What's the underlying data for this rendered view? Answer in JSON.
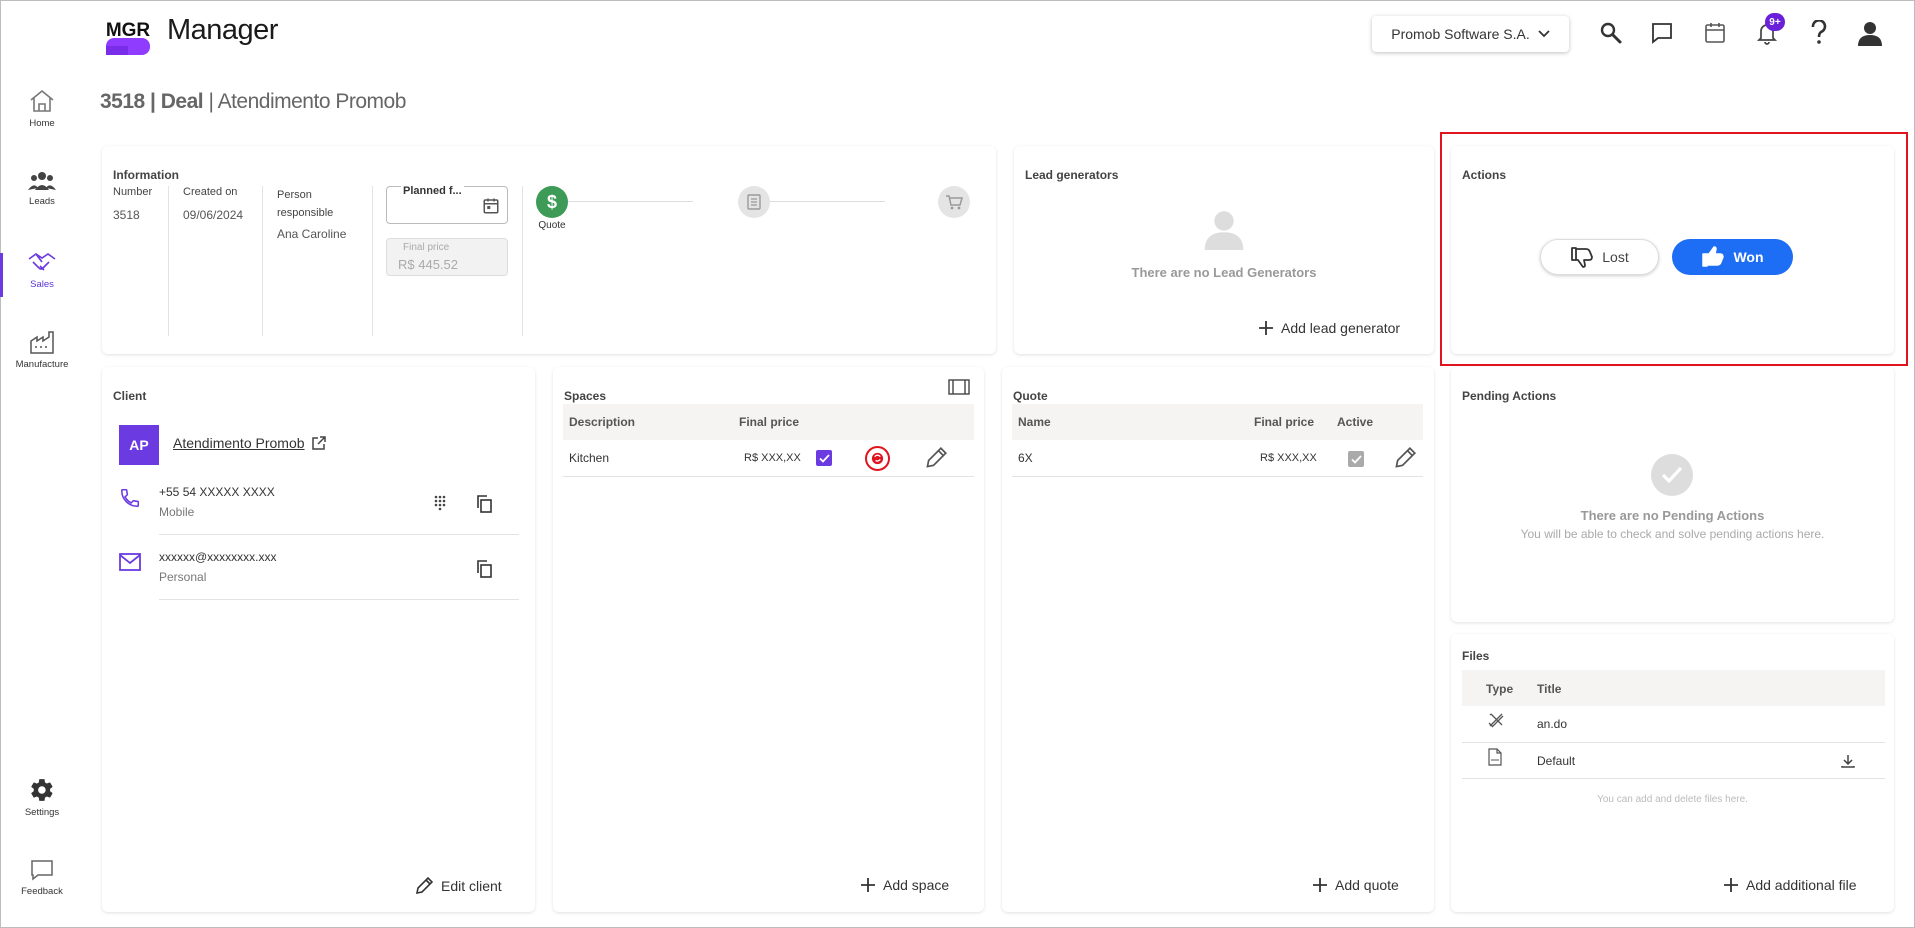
{
  "app": {
    "logo_text": "MGR",
    "title": "Manager"
  },
  "company_select": {
    "value": "Promob Software S.A."
  },
  "notifications": {
    "badge": "9+"
  },
  "sidebar": {
    "items": [
      {
        "label": "Home",
        "icon": "home-icon"
      },
      {
        "label": "Leads",
        "icon": "people-icon"
      },
      {
        "label": "Sales",
        "icon": "handshake-icon"
      },
      {
        "label": "Manufacture",
        "icon": "factory-icon"
      },
      {
        "label": "Settings",
        "icon": "gear-icon"
      },
      {
        "label": "Feedback",
        "icon": "chat-bubble-icon"
      }
    ]
  },
  "page": {
    "number": "3518",
    "type": "Deal",
    "name": "Atendimento Promob"
  },
  "information": {
    "title": "Information",
    "number_label": "Number",
    "number": "3518",
    "created_label": "Created on",
    "created": "09/06/2024",
    "person_label": "Person responsible",
    "person": "Ana Caroline",
    "planned_label": "Planned f...",
    "final_price_label": "Final price",
    "final_price": "R$ 445.52",
    "stage_label": "Quote"
  },
  "lead_generators": {
    "title": "Lead generators",
    "empty": "There are no Lead Generators",
    "add_label": "Add lead generator"
  },
  "actions": {
    "title": "Actions",
    "lost_label": "Lost",
    "won_label": "Won"
  },
  "client": {
    "title": "Client",
    "initials": "AP",
    "name": "Atendimento Promob",
    "phone": "+55 54 XXXXX XXXX",
    "phone_type": "Mobile",
    "email": "xxxxxx@xxxxxxxx.xxx",
    "email_type": "Personal",
    "edit_label": "Edit client"
  },
  "spaces": {
    "title": "Spaces",
    "columns": [
      "Description",
      "Final price"
    ],
    "rows": [
      {
        "description": "Kitchen",
        "price": "R$ XXX,XX"
      }
    ],
    "add_label": "Add space"
  },
  "quote": {
    "title": "Quote",
    "columns": [
      "Name",
      "Final price",
      "Active"
    ],
    "rows": [
      {
        "name": "6X",
        "price": "R$ XXX,XX"
      }
    ],
    "add_label": "Add quote"
  },
  "pending": {
    "title": "Pending Actions",
    "empty": "There are no Pending Actions",
    "sub": "You will be able to check and solve pending actions here."
  },
  "files": {
    "title": "Files",
    "columns": [
      "Type",
      "Title"
    ],
    "rows": [
      {
        "title": "an.do",
        "icon": "pencil-ruler-icon"
      },
      {
        "title": "Default",
        "icon": "pdf-file-icon"
      }
    ],
    "note": "You can add and delete files here.",
    "add_label": "Add additional file"
  },
  "colors": {
    "accent": "#6b3ae0",
    "won": "#1d6ef5",
    "highlight": "#e0141e",
    "success": "#3d9b57"
  }
}
